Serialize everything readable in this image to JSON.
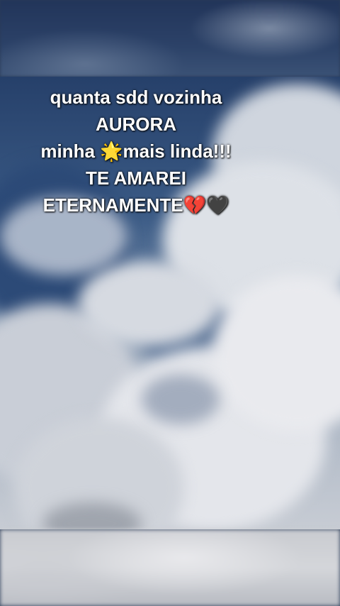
{
  "caption": {
    "line1": "quanta sdd vozinha",
    "line2": "AURORA",
    "line3": "minha 🌟mais linda!!!",
    "line4": "TE AMAREI",
    "line5": "ETERNAMENTE💔🖤"
  },
  "colors": {
    "sky_deep": "#26406a",
    "sky_mid": "#3a5a85",
    "cloud": "#e3e5ea",
    "text": "#ffffff"
  }
}
